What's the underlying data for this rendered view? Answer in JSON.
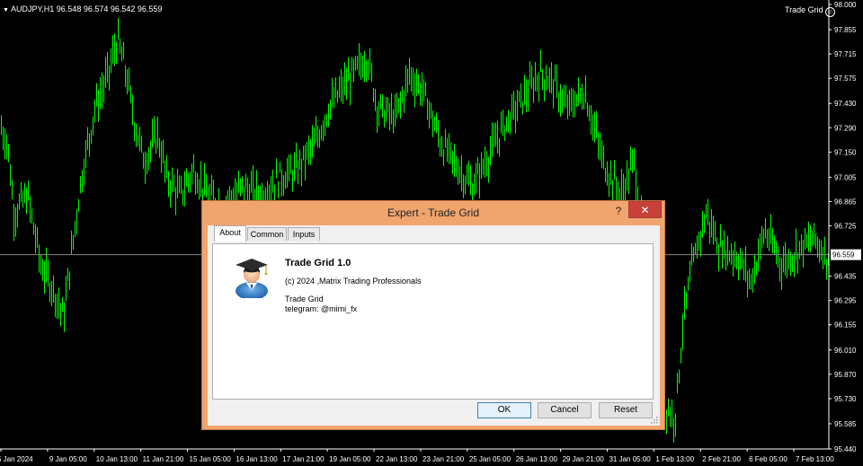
{
  "chart": {
    "symbol_info": "AUDJPY,H1  96.548 96.574 96.542 96.559",
    "ea_label": "Trade Grid",
    "current_price": "96.559",
    "price_labels": [
      "98.000",
      "97.855",
      "97.715",
      "97.575",
      "97.430",
      "97.290",
      "97.150",
      "97.005",
      "96.865",
      "96.725",
      "96.559",
      "96.435",
      "96.295",
      "96.155",
      "96.010",
      "95.870",
      "95.730",
      "95.585",
      "95.440"
    ],
    "time_labels": [
      "5 Jan 2024",
      "9 Jan 05:00",
      "10 Jan 13:00",
      "11 Jan 21:00",
      "15 Jan 05:00",
      "16 Jan 13:00",
      "17 Jan 21:00",
      "19 Jan 05:00",
      "22 Jan 13:00",
      "23 Jan 21:00",
      "25 Jan 05:00",
      "26 Jan 13:00",
      "29 Jan 21:00",
      "31 Jan 05:00",
      "1 Feb 13:00",
      "2 Feb 21:00",
      "6 Feb 05:00",
      "7 Feb 13:00"
    ],
    "bar_color": "#00ff00",
    "background": "#000000"
  },
  "dialog": {
    "title": "Expert - Trade Grid",
    "help": "?",
    "close": "✕",
    "tabs": [
      "About",
      "Common",
      "Inputs"
    ],
    "name": "Trade Grid 1.0",
    "copyright": "(c) 2024 ,Matrix Trading Professionals",
    "desc1": "Trade Grid",
    "desc2": "telegram: @mimi_fx",
    "ok": "OK",
    "cancel": "Cancel",
    "reset": "Reset"
  }
}
